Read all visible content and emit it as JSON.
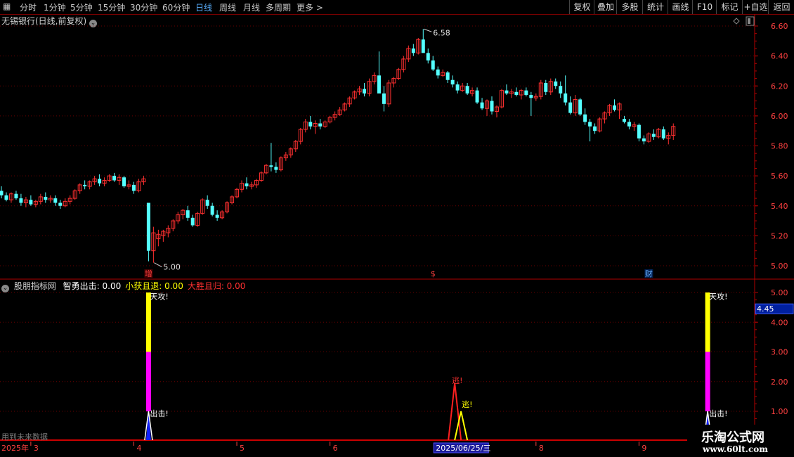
{
  "toolbar": {
    "periods": [
      "分时",
      "1分钟",
      "5分钟",
      "15分钟",
      "30分钟",
      "60分钟",
      "日线",
      "周线",
      "月线",
      "多周期",
      "更多 >"
    ],
    "active_period": "日线",
    "buttons": [
      "复权",
      "叠加",
      "多股",
      "统计",
      "画线",
      "F10",
      "标记",
      "+自选",
      "返回"
    ]
  },
  "main_chart": {
    "title": "无锡银行(日线,前复权)",
    "y_ticks": [
      "6.60",
      "6.40",
      "6.20",
      "6.00",
      "5.80",
      "5.60",
      "5.40",
      "5.20",
      "5.00"
    ],
    "high_label": "6.58",
    "low_label": "5.00",
    "event_markers": [
      "增",
      "$",
      "财"
    ],
    "colors": {
      "up": "#ff3030",
      "down": "#54ffff",
      "grid": "#6a0000",
      "axis": "#b00000"
    }
  },
  "chart_data": {
    "type": "candlestick",
    "ylim": [
      4.95,
      6.65
    ],
    "candles": [
      [
        5.5,
        5.53,
        5.45,
        5.47
      ],
      [
        5.47,
        5.49,
        5.43,
        5.44
      ],
      [
        5.44,
        5.49,
        5.42,
        5.48
      ],
      [
        5.48,
        5.5,
        5.44,
        5.45
      ],
      [
        5.45,
        5.48,
        5.4,
        5.42
      ],
      [
        5.42,
        5.46,
        5.39,
        5.44
      ],
      [
        5.44,
        5.47,
        5.4,
        5.41
      ],
      [
        5.41,
        5.44,
        5.39,
        5.43
      ],
      [
        5.43,
        5.48,
        5.41,
        5.46
      ],
      [
        5.46,
        5.49,
        5.42,
        5.44
      ],
      [
        5.44,
        5.47,
        5.42,
        5.45
      ],
      [
        5.45,
        5.47,
        5.4,
        5.42
      ],
      [
        5.42,
        5.44,
        5.38,
        5.4
      ],
      [
        5.4,
        5.45,
        5.39,
        5.43
      ],
      [
        5.43,
        5.47,
        5.41,
        5.45
      ],
      [
        5.45,
        5.51,
        5.44,
        5.5
      ],
      [
        5.5,
        5.55,
        5.48,
        5.54
      ],
      [
        5.54,
        5.57,
        5.51,
        5.53
      ],
      [
        5.53,
        5.57,
        5.51,
        5.56
      ],
      [
        5.56,
        5.6,
        5.54,
        5.58
      ],
      [
        5.58,
        5.61,
        5.53,
        5.55
      ],
      [
        5.55,
        5.59,
        5.53,
        5.57
      ],
      [
        5.57,
        5.61,
        5.56,
        5.6
      ],
      [
        5.6,
        5.62,
        5.56,
        5.57
      ],
      [
        5.57,
        5.61,
        5.54,
        5.59
      ],
      [
        5.59,
        5.6,
        5.52,
        5.53
      ],
      [
        5.53,
        5.57,
        5.51,
        5.54
      ],
      [
        5.54,
        5.56,
        5.48,
        5.5
      ],
      [
        5.5,
        5.58,
        5.49,
        5.56
      ],
      [
        5.56,
        5.6,
        5.54,
        5.58
      ],
      [
        5.42,
        5.42,
        5.03,
        5.1
      ],
      [
        5.1,
        5.26,
        5.02,
        5.22
      ],
      [
        5.18,
        5.24,
        5.13,
        5.21
      ],
      [
        5.2,
        5.24,
        5.16,
        5.23
      ],
      [
        5.22,
        5.27,
        5.19,
        5.25
      ],
      [
        5.25,
        5.31,
        5.23,
        5.3
      ],
      [
        5.3,
        5.36,
        5.28,
        5.34
      ],
      [
        5.34,
        5.38,
        5.31,
        5.37
      ],
      [
        5.37,
        5.4,
        5.3,
        5.32
      ],
      [
        5.32,
        5.34,
        5.26,
        5.27
      ],
      [
        5.27,
        5.36,
        5.26,
        5.35
      ],
      [
        5.35,
        5.45,
        5.34,
        5.44
      ],
      [
        5.44,
        5.47,
        5.38,
        5.4
      ],
      [
        5.4,
        5.42,
        5.33,
        5.34
      ],
      [
        5.34,
        5.37,
        5.3,
        5.32
      ],
      [
        5.32,
        5.37,
        5.31,
        5.36
      ],
      [
        5.36,
        5.43,
        5.35,
        5.42
      ],
      [
        5.42,
        5.47,
        5.41,
        5.46
      ],
      [
        5.46,
        5.52,
        5.45,
        5.51
      ],
      [
        5.51,
        5.57,
        5.49,
        5.55
      ],
      [
        5.55,
        5.59,
        5.51,
        5.53
      ],
      [
        5.53,
        5.56,
        5.51,
        5.54
      ],
      [
        5.54,
        5.58,
        5.52,
        5.57
      ],
      [
        5.57,
        5.63,
        5.56,
        5.62
      ],
      [
        5.62,
        5.68,
        5.61,
        5.67
      ],
      [
        5.67,
        5.82,
        5.63,
        5.66
      ],
      [
        5.66,
        5.69,
        5.62,
        5.64
      ],
      [
        5.64,
        5.73,
        5.63,
        5.72
      ],
      [
        5.72,
        5.76,
        5.7,
        5.74
      ],
      [
        5.74,
        5.79,
        5.72,
        5.78
      ],
      [
        5.78,
        5.84,
        5.76,
        5.83
      ],
      [
        5.83,
        5.92,
        5.81,
        5.91
      ],
      [
        5.91,
        5.98,
        5.89,
        5.96
      ],
      [
        5.96,
        6.0,
        5.91,
        5.93
      ],
      [
        5.93,
        5.97,
        5.88,
        5.95
      ],
      [
        5.95,
        5.98,
        5.91,
        5.93
      ],
      [
        5.93,
        5.97,
        5.92,
        5.96
      ],
      [
        5.96,
        6.0,
        5.95,
        5.99
      ],
      [
        5.99,
        6.03,
        5.97,
        6.01
      ],
      [
        6.01,
        6.06,
        6.0,
        6.04
      ],
      [
        6.04,
        6.09,
        6.03,
        6.08
      ],
      [
        6.08,
        6.13,
        6.06,
        6.12
      ],
      [
        6.12,
        6.17,
        6.11,
        6.16
      ],
      [
        6.16,
        6.2,
        6.14,
        6.18
      ],
      [
        6.18,
        6.22,
        6.13,
        6.15
      ],
      [
        6.15,
        6.25,
        6.13,
        6.23
      ],
      [
        6.23,
        6.29,
        6.21,
        6.27
      ],
      [
        6.27,
        6.43,
        6.24,
        6.15
      ],
      [
        6.15,
        6.2,
        6.03,
        6.08
      ],
      [
        6.08,
        6.24,
        6.06,
        6.22
      ],
      [
        6.22,
        6.26,
        6.19,
        6.25
      ],
      [
        6.25,
        6.32,
        6.24,
        6.31
      ],
      [
        6.31,
        6.4,
        6.29,
        6.38
      ],
      [
        6.38,
        6.47,
        6.36,
        6.45
      ],
      [
        6.45,
        6.48,
        6.4,
        6.42
      ],
      [
        6.42,
        6.52,
        6.41,
        6.51
      ],
      [
        6.51,
        6.58,
        6.47,
        6.42
      ],
      [
        6.42,
        6.45,
        6.35,
        6.37
      ],
      [
        6.37,
        6.4,
        6.3,
        6.31
      ],
      [
        6.31,
        6.33,
        6.25,
        6.27
      ],
      [
        6.27,
        6.31,
        6.26,
        6.29
      ],
      [
        6.29,
        6.3,
        6.22,
        6.24
      ],
      [
        6.24,
        6.27,
        6.19,
        6.21
      ],
      [
        6.21,
        6.23,
        6.15,
        6.17
      ],
      [
        6.17,
        6.22,
        6.16,
        6.2
      ],
      [
        6.2,
        6.22,
        6.14,
        6.15
      ],
      [
        6.15,
        6.19,
        6.13,
        6.17
      ],
      [
        6.17,
        6.19,
        6.08,
        6.09
      ],
      [
        6.09,
        6.12,
        6.04,
        6.05
      ],
      [
        6.05,
        6.11,
        6.0,
        6.1
      ],
      [
        6.1,
        6.13,
        6.01,
        6.03
      ],
      [
        6.03,
        6.07,
        5.99,
        6.06
      ],
      [
        6.06,
        6.18,
        6.05,
        6.17
      ],
      [
        6.17,
        6.21,
        6.14,
        6.15
      ],
      [
        6.15,
        6.18,
        6.12,
        6.16
      ],
      [
        6.16,
        6.19,
        6.13,
        6.14
      ],
      [
        6.14,
        6.18,
        6.11,
        6.17
      ],
      [
        6.17,
        6.19,
        6.13,
        6.14
      ],
      [
        6.14,
        6.16,
        6.0,
        6.12
      ],
      [
        6.12,
        6.15,
        6.1,
        6.13
      ],
      [
        6.13,
        6.24,
        6.11,
        6.22
      ],
      [
        6.22,
        6.24,
        6.14,
        6.16
      ],
      [
        6.16,
        6.25,
        6.14,
        6.23
      ],
      [
        6.23,
        6.25,
        6.18,
        6.2
      ],
      [
        6.2,
        6.23,
        6.12,
        6.15
      ],
      [
        6.15,
        6.27,
        6.07,
        6.09
      ],
      [
        6.09,
        6.13,
        6.01,
        6.02
      ],
      [
        6.02,
        6.14,
        6.0,
        6.11
      ],
      [
        6.11,
        6.12,
        6.0,
        6.01
      ],
      [
        6.01,
        6.05,
        5.94,
        5.96
      ],
      [
        5.96,
        5.98,
        5.83,
        5.93
      ],
      [
        5.93,
        5.95,
        5.88,
        5.9
      ],
      [
        5.9,
        5.99,
        5.89,
        5.98
      ],
      [
        5.98,
        6.03,
        5.95,
        6.02
      ],
      [
        6.02,
        6.08,
        6.0,
        6.07
      ],
      [
        6.07,
        6.11,
        6.03,
        6.04
      ],
      [
        6.04,
        6.09,
        5.98,
        6.08
      ],
      [
        5.98,
        6.0,
        5.95,
        5.96
      ],
      [
        5.96,
        5.98,
        5.91,
        5.93
      ],
      [
        5.93,
        5.96,
        5.9,
        5.94
      ],
      [
        5.94,
        5.95,
        5.83,
        5.85
      ],
      [
        5.85,
        5.87,
        5.81,
        5.83
      ],
      [
        5.83,
        5.89,
        5.82,
        5.88
      ],
      [
        5.88,
        5.91,
        5.84,
        5.86
      ],
      [
        5.86,
        5.92,
        5.85,
        5.91
      ],
      [
        5.91,
        5.93,
        5.84,
        5.85
      ],
      [
        5.85,
        5.89,
        5.81,
        5.87
      ],
      [
        5.87,
        5.95,
        5.84,
        5.93
      ]
    ],
    "event_marker_indices": [
      30,
      88,
      132
    ],
    "indicator": {
      "name": "股朋指标网",
      "lines": [
        {
          "label": "智勇出击:",
          "value": "0.00",
          "color": "#ffffff"
        },
        {
          "label": "小获且退:",
          "value": "0.00",
          "color": "#ffff00"
        },
        {
          "label": "大胜且归:",
          "value": "0.00",
          "color": "#ff3030"
        }
      ],
      "ylim": [
        0,
        5.3
      ],
      "y_ticks": [
        "5.00",
        "4.00",
        "3.00",
        "2.00",
        "1.00"
      ],
      "current_value": "4.45",
      "attack_signals": [
        {
          "index": 30,
          "label_top": "天攻!",
          "label_bottom": "出击!"
        },
        {
          "index": 144,
          "label_top": "天攻!",
          "label_bottom": "出击!"
        }
      ],
      "escape_signals": [
        {
          "index": 93,
          "peak": 1.95,
          "color": "#ff2020",
          "label": "逃!"
        },
        {
          "index": 94,
          "peak": 1.0,
          "color": "#ffff00",
          "label": "逃!"
        }
      ],
      "note": "用到未来数据"
    },
    "x_axis": {
      "labels": [
        {
          "text": "2025年",
          "index": -1
        },
        {
          "text": "3",
          "index": 6
        },
        {
          "text": "4",
          "index": 27
        },
        {
          "text": "5",
          "index": 48
        },
        {
          "text": "6",
          "index": 67
        },
        {
          "text": "2025/06/25/三",
          "index": 88,
          "highlight": true
        },
        {
          "text": "8",
          "index": 109
        },
        {
          "text": "9",
          "index": 130
        }
      ]
    }
  },
  "watermark": {
    "title": "乐淘公式网",
    "url": "www.60lt.com"
  }
}
